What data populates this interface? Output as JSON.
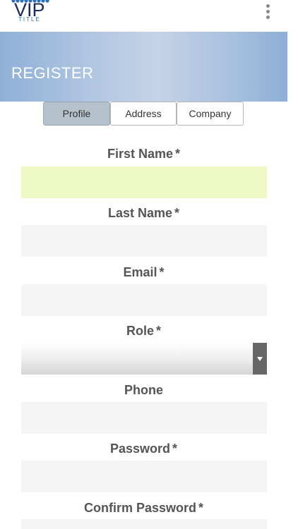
{
  "header": {
    "logo_text": "VIP",
    "logo_subtext": "TITLE",
    "menu_icon": "more-vertical-icon"
  },
  "banner": {
    "title": "REGISTER"
  },
  "tabs": [
    {
      "label": "Profile",
      "active": true
    },
    {
      "label": "Address",
      "active": false
    },
    {
      "label": "Company",
      "active": false
    }
  ],
  "form": {
    "first_name": {
      "label": "First Name",
      "required": "*",
      "value": ""
    },
    "last_name": {
      "label": "Last Name",
      "required": "*",
      "value": ""
    },
    "email": {
      "label": "Email",
      "required": "*",
      "value": ""
    },
    "role": {
      "label": "Role",
      "required": "*",
      "value": ""
    },
    "phone": {
      "label": "Phone",
      "value": ""
    },
    "password": {
      "label": "Password",
      "required": "*",
      "value": ""
    },
    "confirm_password": {
      "label": "Confirm Password",
      "required": "*",
      "value": ""
    }
  },
  "colors": {
    "banner": "#b4c8e2",
    "active_tab": "#b6c2cb",
    "focused_input": "#eef8c4",
    "input_bg": "#f5f5f5",
    "logo": "#1d2b57",
    "logo_accent": "#2a6fb5"
  }
}
